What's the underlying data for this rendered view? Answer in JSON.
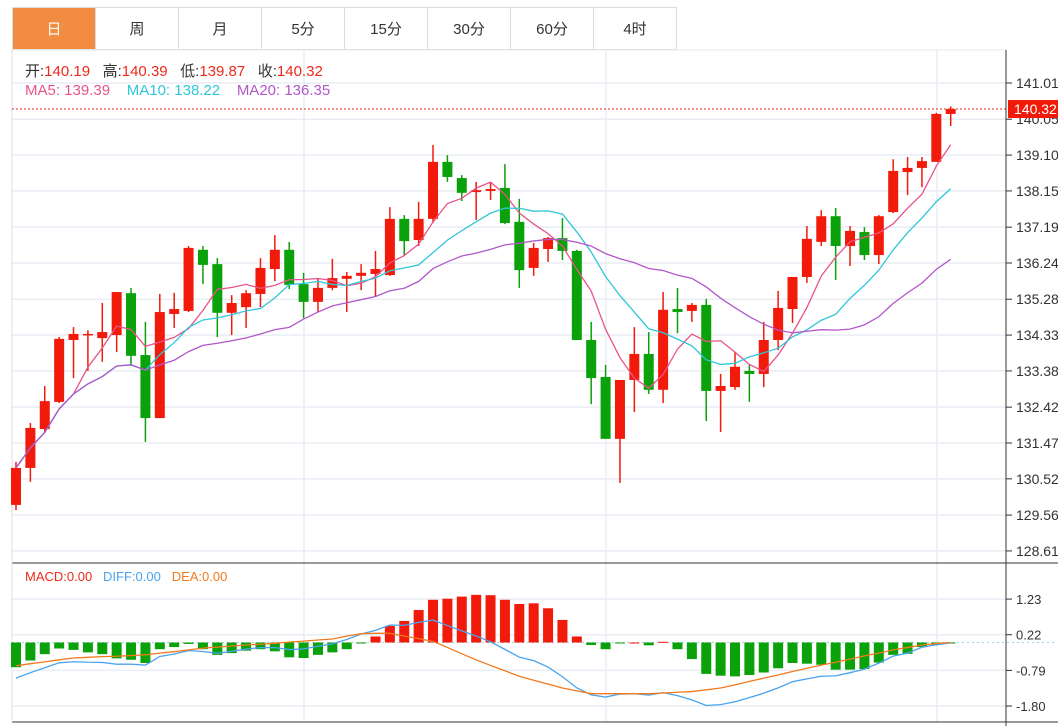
{
  "tabs": [
    {
      "label": "日",
      "active": true
    },
    {
      "label": "周"
    },
    {
      "label": "月"
    },
    {
      "label": "5分"
    },
    {
      "label": "15分"
    },
    {
      "label": "30分"
    },
    {
      "label": "60分"
    },
    {
      "label": "4时"
    }
  ],
  "ohlc_legend": {
    "open_label": "开:",
    "open": "140.19",
    "high_label": "高:",
    "high": "140.39",
    "low_label": "低:",
    "low": "139.87",
    "close_label": "收:",
    "close": "140.32"
  },
  "ma_legend": {
    "ma5": "MA5: 139.39",
    "ma10": "MA10: 138.22",
    "ma20": "MA20: 136.35"
  },
  "macd_legend": {
    "macd": "MACD:0.00",
    "diff": "DIFF:0.00",
    "dea": "DEA:0.00"
  },
  "colors": {
    "up": "#f21a0a",
    "down": "#0aa10a",
    "ma5": "#e9538b",
    "ma10": "#2fc6da",
    "ma20": "#b257c9",
    "diff": "#4aa3ef",
    "dea": "#f27a1e",
    "active_tab": "#f28c40"
  },
  "chart_data": [
    {
      "type": "candlestick",
      "last_price_tag": "140.32",
      "y_ticks": [
        "141.01",
        "140.05",
        "139.10",
        "138.15",
        "137.19",
        "136.24",
        "135.28",
        "134.33",
        "133.38",
        "132.42",
        "131.47",
        "130.52",
        "129.56",
        "128.61"
      ],
      "ylim": [
        128.61,
        141.01
      ],
      "grid": true,
      "candles": [
        [
          129.83,
          130.97,
          129.69,
          130.81
        ],
        [
          130.81,
          132.0,
          130.44,
          131.87
        ],
        [
          131.84,
          132.98,
          131.76,
          132.58
        ],
        [
          132.56,
          134.28,
          132.53,
          134.23
        ],
        [
          134.2,
          134.54,
          133.19,
          134.36
        ],
        [
          134.33,
          134.46,
          133.38,
          134.36
        ],
        [
          134.25,
          135.18,
          133.62,
          134.41
        ],
        [
          134.33,
          135.47,
          133.88,
          135.47
        ],
        [
          135.44,
          135.58,
          133.51,
          133.78
        ],
        [
          133.8,
          134.68,
          131.5,
          132.13
        ],
        [
          132.13,
          135.42,
          132.13,
          134.94
        ],
        [
          134.89,
          135.45,
          134.52,
          135.02
        ],
        [
          134.97,
          136.69,
          134.94,
          136.64
        ],
        [
          136.59,
          136.69,
          135.68,
          136.19
        ],
        [
          136.21,
          136.37,
          134.28,
          134.92
        ],
        [
          134.92,
          135.39,
          134.33,
          135.18
        ],
        [
          135.07,
          135.52,
          134.52,
          135.44
        ],
        [
          135.42,
          136.37,
          135.07,
          136.11
        ],
        [
          136.08,
          136.98,
          135.76,
          136.59
        ],
        [
          136.59,
          136.8,
          135.55,
          135.66
        ],
        [
          135.68,
          135.98,
          134.78,
          135.21
        ],
        [
          135.21,
          135.84,
          134.94,
          135.58
        ],
        [
          135.58,
          136.35,
          135.52,
          135.84
        ],
        [
          135.82,
          136.0,
          134.94,
          135.9
        ],
        [
          135.9,
          136.21,
          135.52,
          135.98
        ],
        [
          135.95,
          136.56,
          135.34,
          136.08
        ],
        [
          135.92,
          137.72,
          135.9,
          137.41
        ],
        [
          137.41,
          137.51,
          136.45,
          136.82
        ],
        [
          136.85,
          137.86,
          136.69,
          137.41
        ],
        [
          137.41,
          139.37,
          137.3,
          138.92
        ],
        [
          138.92,
          139.1,
          138.39,
          138.52
        ],
        [
          138.49,
          138.57,
          137.88,
          138.1
        ],
        [
          138.12,
          138.39,
          137.38,
          138.17
        ],
        [
          138.15,
          138.39,
          137.91,
          138.2
        ],
        [
          138.23,
          138.86,
          137.27,
          137.3
        ],
        [
          137.33,
          137.94,
          135.58,
          136.05
        ],
        [
          136.11,
          136.77,
          135.9,
          136.64
        ],
        [
          136.61,
          136.93,
          136.27,
          136.9
        ],
        [
          136.9,
          137.43,
          136.32,
          136.56
        ],
        [
          136.56,
          136.59,
          134.2,
          134.2
        ],
        [
          134.2,
          134.68,
          132.5,
          133.19
        ],
        [
          133.22,
          133.54,
          131.58,
          131.58
        ],
        [
          131.58,
          133.14,
          130.41,
          133.14
        ],
        [
          133.14,
          134.54,
          132.29,
          133.83
        ],
        [
          133.83,
          134.41,
          132.77,
          132.88
        ],
        [
          132.88,
          135.47,
          132.53,
          135.0
        ],
        [
          135.02,
          135.58,
          134.38,
          134.94
        ],
        [
          134.97,
          135.18,
          134.68,
          135.13
        ],
        [
          135.13,
          135.29,
          132.05,
          132.85
        ],
        [
          132.85,
          133.3,
          131.76,
          132.98
        ],
        [
          132.95,
          133.88,
          132.88,
          133.49
        ],
        [
          133.38,
          133.54,
          132.56,
          133.3
        ],
        [
          133.3,
          134.68,
          132.95,
          134.2
        ],
        [
          134.2,
          135.5,
          133.93,
          135.05
        ],
        [
          135.02,
          135.87,
          134.65,
          135.87
        ],
        [
          135.87,
          137.22,
          135.71,
          136.88
        ],
        [
          136.8,
          137.64,
          136.69,
          137.48
        ],
        [
          137.48,
          137.7,
          135.79,
          136.69
        ],
        [
          136.69,
          137.22,
          136.16,
          137.09
        ],
        [
          137.06,
          137.19,
          136.32,
          136.45
        ],
        [
          136.45,
          137.51,
          136.21,
          137.48
        ],
        [
          137.59,
          138.99,
          137.56,
          138.68
        ],
        [
          138.65,
          139.05,
          138.04,
          138.76
        ],
        [
          138.76,
          139.05,
          138.25,
          138.94
        ],
        [
          138.92,
          140.22,
          138.92,
          140.19
        ],
        [
          140.19,
          140.39,
          139.87,
          140.32
        ]
      ],
      "candle_format": [
        "open",
        "high",
        "low",
        "close"
      ],
      "series": [
        {
          "name": "MA5",
          "period": 5
        },
        {
          "name": "MA10",
          "period": 10
        },
        {
          "name": "MA20",
          "period": 20
        }
      ]
    },
    {
      "type": "bar",
      "y_ticks": [
        "1.23",
        "0.22",
        "-0.79",
        "-1.80"
      ],
      "ylim": [
        -1.8,
        1.23
      ],
      "histogram": [
        -0.7,
        -0.51,
        -0.33,
        -0.17,
        -0.21,
        -0.28,
        -0.33,
        -0.45,
        -0.49,
        -0.58,
        -0.19,
        -0.13,
        -0.04,
        -0.19,
        -0.35,
        -0.3,
        -0.23,
        -0.19,
        -0.25,
        -0.42,
        -0.44,
        -0.35,
        -0.28,
        -0.19,
        -0.02,
        0.17,
        0.47,
        0.61,
        0.92,
        1.21,
        1.24,
        1.3,
        1.35,
        1.34,
        1.21,
        1.09,
        1.11,
        0.97,
        0.64,
        0.17,
        -0.07,
        -0.19,
        -0.02,
        0.0,
        -0.08,
        0.02,
        -0.19,
        -0.47,
        -0.89,
        -0.94,
        -0.96,
        -0.92,
        -0.85,
        -0.73,
        -0.58,
        -0.6,
        -0.63,
        -0.77,
        -0.77,
        -0.75,
        -0.57,
        -0.35,
        -0.32,
        -0.13,
        -0.07,
        -0.02
      ],
      "dea": [
        -0.66,
        -0.6,
        -0.55,
        -0.49,
        -0.44,
        -0.42,
        -0.4,
        -0.39,
        -0.37,
        -0.35,
        -0.3,
        -0.26,
        -0.21,
        -0.16,
        -0.13,
        -0.1,
        -0.07,
        -0.05,
        -0.02,
        0.01,
        0.04,
        0.07,
        0.1,
        0.18,
        0.25,
        0.26,
        0.26,
        0.18,
        0.11,
        0.03,
        -0.14,
        -0.32,
        -0.49,
        -0.65,
        -0.8,
        -0.96,
        -1.07,
        -1.18,
        -1.29,
        -1.37,
        -1.45,
        -1.45,
        -1.45,
        -1.45,
        -1.45,
        -1.43,
        -1.41,
        -1.39,
        -1.34,
        -1.29,
        -1.2,
        -1.1,
        -1.01,
        -0.92,
        -0.82,
        -0.73,
        -0.64,
        -0.56,
        -0.47,
        -0.38,
        -0.3,
        -0.21,
        -0.14,
        -0.07,
        -0.03,
        0.0
      ]
    }
  ]
}
